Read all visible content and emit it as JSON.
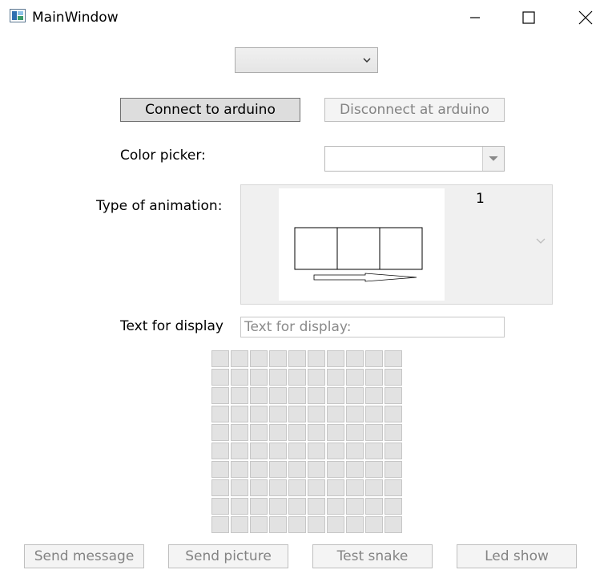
{
  "window": {
    "title": "MainWindow"
  },
  "top_combo": {
    "selected": ""
  },
  "buttons": {
    "connect": "Connect to arduino",
    "disconnect": "Disconnect at arduino",
    "send_message": "Send message",
    "send_picture": "Send picture",
    "test_snake": "Test snake",
    "led_show": "Led show"
  },
  "labels": {
    "color_picker": "Color picker:",
    "type_of_animation": "Type of animation:",
    "text_for_display": "Text for display"
  },
  "color_picker": {
    "selected": ""
  },
  "animation": {
    "selected_index": "1"
  },
  "text_input": {
    "placeholder": "Text for display:",
    "value": ""
  },
  "led_grid": {
    "rows": 10,
    "cols": 10
  },
  "icons": {
    "app": "app-window-icon",
    "minimize": "minimize-icon",
    "maximize": "maximize-icon",
    "close": "close-icon",
    "dropdown": "chevron-down-icon"
  }
}
